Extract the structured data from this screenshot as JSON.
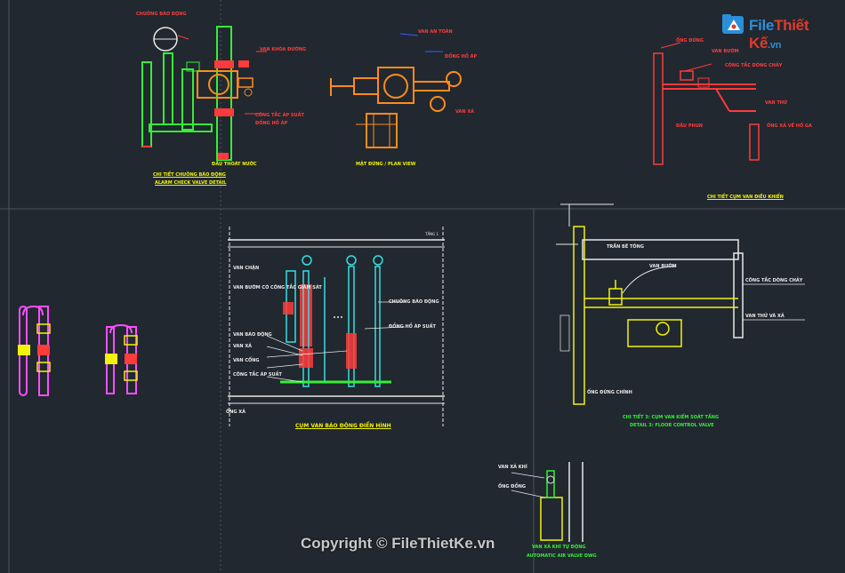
{
  "watermark": {
    "logo_text_a": "File",
    "logo_text_b": "Thiết Kế",
    "logo_text_c": ".vn",
    "copyright": "Copyright © FileThietKe.vn"
  },
  "labels": {
    "detail1_title_vi": "CHI TIẾT CHUÔNG BÁO ĐỘNG",
    "detail1_title_en": "ALARM CHECK VALVE DETAIL",
    "detail1_note_top": "CHUÔNG BÁO ĐỘNG",
    "detail1_note_1": "VAN KHÓA ĐƯỜNG",
    "detail1_note_2": "CÔNG TẮC ÁP SUẤT",
    "detail1_note_3": "ĐỒNG HỒ ÁP",
    "detail1_note_4": "ĐẦU THOÁT NƯỚC",
    "detail2_title": "MẶT ĐỨNG / PLAN VIEW",
    "detail2_note_1": "VAN AN TOÀN",
    "detail2_note_2": "ĐỒNG HỒ ÁP",
    "detail2_note_3": "VAN XẢ",
    "detail3_title": "CHI TIẾT CỤM VAN ĐIỀU KHIỂN",
    "detail3_note_1": "ỐNG ĐỨNG",
    "detail3_note_2": "VAN BƯỚM",
    "detail3_note_3": "CÔNG TẮC DÒNG CHẢY",
    "detail3_note_4": "VAN THỬ",
    "detail3_note_5": "ĐẦU PHUN",
    "detail3_note_6": "ỐNG XẢ VỀ HỐ GA",
    "detail4_title": "CỤM VAN BÁO ĐỘNG ĐIỂN HÌNH",
    "detail4_level": "TẦNG 1",
    "detail4_note_1": "VAN CHẶN",
    "detail4_note_2": "VAN BƯỚM CÓ CÔNG TẮC GIÁM SÁT",
    "detail4_note_3": "CHUÔNG BÁO ĐỘNG",
    "detail4_note_4": "ĐỒNG HỒ ÁP SUẤT",
    "detail4_note_5": "VAN BÁO ĐỘNG",
    "detail4_note_6": "VAN XẢ",
    "detail4_note_7": "VAN CỔNG",
    "detail4_note_8": "CÔNG TẮC ÁP SUẤT",
    "detail4_note_9": "ỐNG XẢ",
    "detail5_title_vi": "CHI TIẾT 3: CỤM VAN KIỂM SOÁT TẦNG",
    "detail5_title_en": "DETAIL 3: FLOOR CONTROL VALVE",
    "detail5_note_1": "TRẦN BÊ TÔNG",
    "detail5_note_2": "VAN BƯỚM",
    "detail5_note_3": "CÔNG TẮC DÒNG CHẢY",
    "detail5_note_4": "VAN THỬ VÀ XẢ",
    "detail5_note_5": "ỐNG ĐỨNG CHÍNH",
    "detail6_title_vi": "VAN XẢ KHÍ TỰ ĐỘNG",
    "detail6_title_en": "AUTOMATIC AIR VALVE DWG",
    "detail6_note_1": "VAN XẢ KHÍ",
    "detail6_note_2": "ỐNG ĐỒNG"
  },
  "colors": {
    "background": "#212830",
    "cad_red": "#ff3b3b",
    "cad_green": "#35ee35",
    "cad_yellow": "#f2f20a",
    "cad_orange": "#ff8c1a",
    "cad_cyan": "#34e0e0",
    "cad_white": "#e8e8e8",
    "cad_magenta": "#ff4dff",
    "cad_blue": "#3a5cff",
    "logo_blue": "#2b8fd9",
    "logo_red": "#e23a2a"
  }
}
